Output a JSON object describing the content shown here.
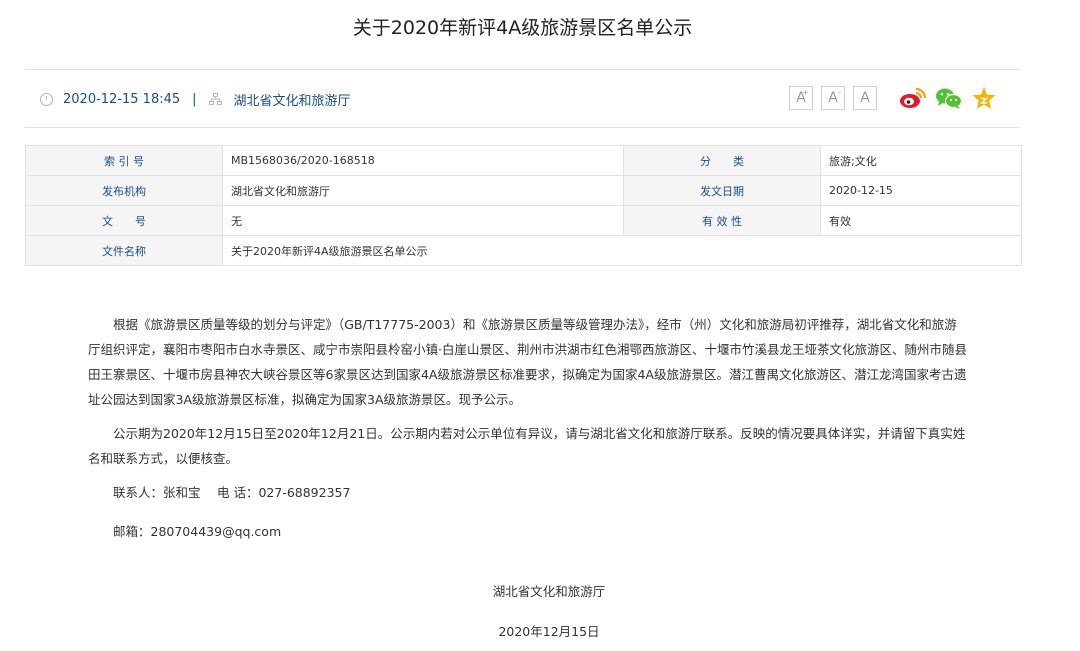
{
  "title": "关于2020年新评4A级旅游景区名单公示",
  "meta": {
    "datetime": "2020-12-15 18:45",
    "separator": "|",
    "publisher": "湖北省文化和旅游厅",
    "icons": [
      "clock-icon",
      "org-icon"
    ]
  },
  "toolbar": {
    "font_large": "A",
    "font_large_sup": "+",
    "font_small": "A",
    "font_small_sup": "-",
    "font_reset": "A",
    "share_icons": [
      "weibo-icon",
      "wechat-icon",
      "favorite-star-icon"
    ],
    "colors": {
      "weibo": "#e6162d",
      "wechat": "#51c332",
      "star": "#f5b400"
    }
  },
  "info_table": {
    "rows": [
      [
        {
          "k": "索 引 号",
          "v": "MB1568036/2020-168518"
        },
        {
          "k": "分　　类",
          "v": "旅游;文化"
        }
      ],
      [
        {
          "k": "发布机构",
          "v": "湖北省文化和旅游厅"
        },
        {
          "k": "发文日期",
          "v": "2020-12-15"
        }
      ],
      [
        {
          "k": "文　　号",
          "v": "无"
        },
        {
          "k": "有 效 性",
          "v": "有效"
        }
      ]
    ],
    "file_name_label": "文件名称",
    "file_name": "关于2020年新评4A级旅游景区名单公示"
  },
  "content": {
    "p1": "根据《旅游景区质量等级的划分与评定》（GB/T17775-2003）和《旅游景区质量等级管理办法》，经市（州）文化和旅游局初评推荐，湖北省文化和旅游厅组织评定，襄阳市枣阳市白水寺景区、咸宁市崇阳县柃窑小镇·白崖山景区、荆州市洪湖市红色湘鄂西旅游区、十堰市竹溪县龙王垭茶文化旅游区、随州市随县田王寨景区、十堰市房县神农大峡谷景区等6家景区达到国家4A级旅游景区标准要求，拟确定为国家4A级旅游景区。潜江曹禺文化旅游区、潜江龙湾国家考古遗址公园达到国家3A级旅游景区标准，拟确定为国家3A级旅游景区。现予公示。",
    "p2": "公示期为2020年12月15日至2020年12月21日。公示期内若对公示单位有异议，请与湖北省文化和旅游厅联系。反映的情况要具体详实，并请留下真实姓名和联系方式，以便核查。",
    "contact": "联系人：张和宝　 电 话：027-68892357",
    "email": "邮箱：280704439@qq.com",
    "signature_org": "湖北省文化和旅游厅",
    "signature_date": "2020年12月15日"
  },
  "colors": {
    "link": "#1a4d8f",
    "label_bg": "#f5f5f5",
    "border": "#e1e1e1"
  }
}
